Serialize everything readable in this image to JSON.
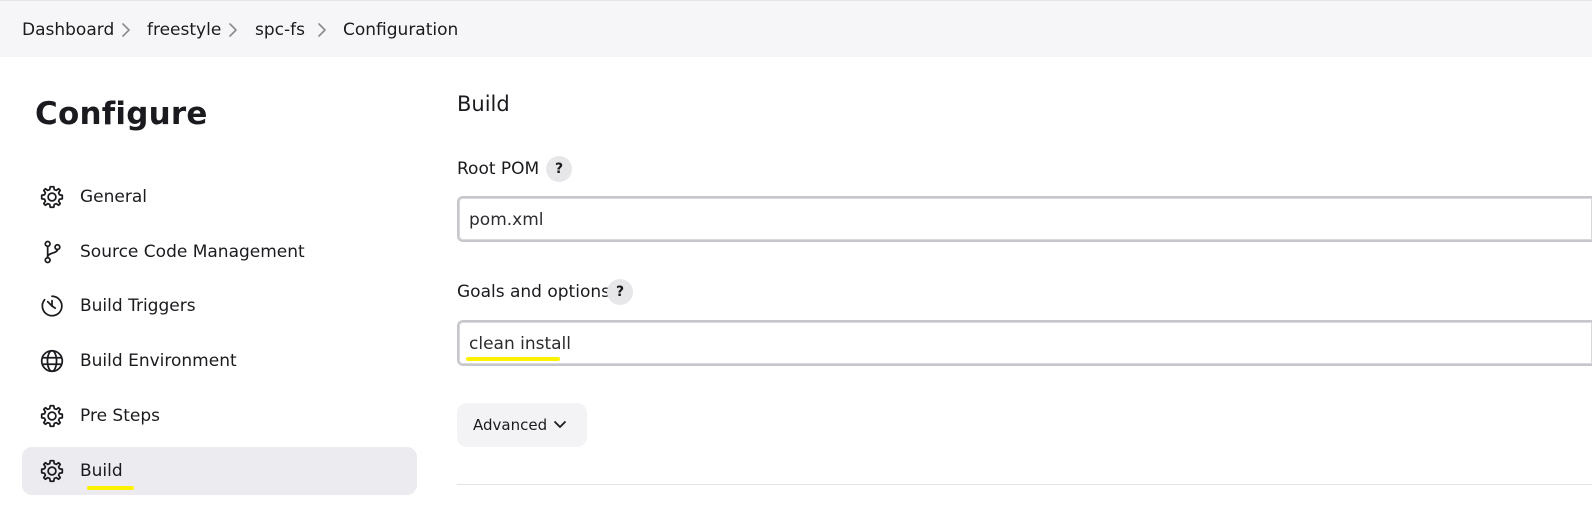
{
  "breadcrumb": {
    "items": [
      "Dashboard",
      "freestyle",
      "spc-fs",
      "Configuration"
    ]
  },
  "sidebar": {
    "title": "Configure",
    "items": [
      {
        "label": "General",
        "icon": "gear-icon"
      },
      {
        "label": "Source Code Management",
        "icon": "branch-icon"
      },
      {
        "label": "Build Triggers",
        "icon": "timer-icon"
      },
      {
        "label": "Build Environment",
        "icon": "globe-icon"
      },
      {
        "label": "Pre Steps",
        "icon": "gear-icon"
      },
      {
        "label": "Build",
        "icon": "gear-icon",
        "active": true
      }
    ]
  },
  "main": {
    "section_title": "Build",
    "root_pom": {
      "label": "Root POM",
      "help": "?",
      "value": "pom.xml"
    },
    "goals": {
      "label": "Goals and options",
      "help": "?",
      "value": "clean install"
    },
    "advanced_label": "Advanced"
  },
  "colors": {
    "highlight": "#fff200",
    "active_nav_bg": "#ebebf0",
    "topbar_bg": "#f6f6f8"
  }
}
